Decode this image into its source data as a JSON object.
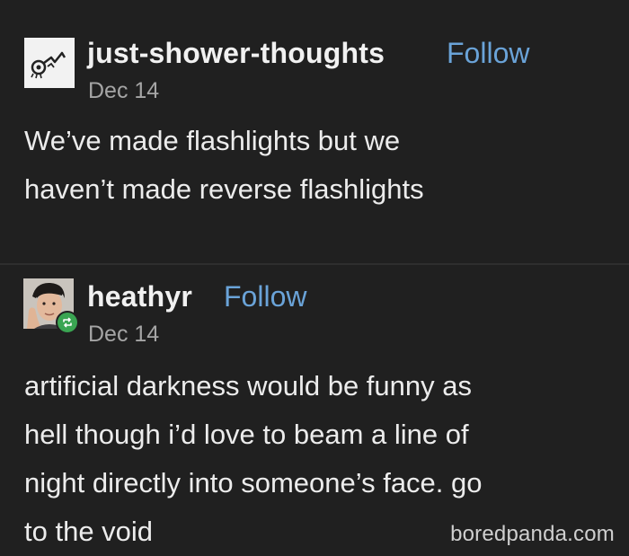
{
  "posts": [
    {
      "username": "just-shower-thoughts",
      "follow_label": "Follow",
      "date": "Dec 14",
      "avatar_icon": "shower-thoughts-logo-icon",
      "lines": [
        "We’ve made flashlights but we",
        "haven’t made reverse flashlights"
      ]
    },
    {
      "username": "heathyr",
      "follow_label": "Follow",
      "date": "Dec 14",
      "avatar_icon": "user-portrait-icon",
      "badge_icon": "reblog-icon",
      "lines": [
        "artificial darkness would be funny as",
        "hell though i’d love to beam a line of",
        "night directly into someone’s face. go",
        "to the void"
      ]
    }
  ],
  "watermark": "boredpanda.com",
  "colors": {
    "background": "#202020",
    "follow": "#6aa3d8",
    "reblog_badge": "#3aa552"
  }
}
